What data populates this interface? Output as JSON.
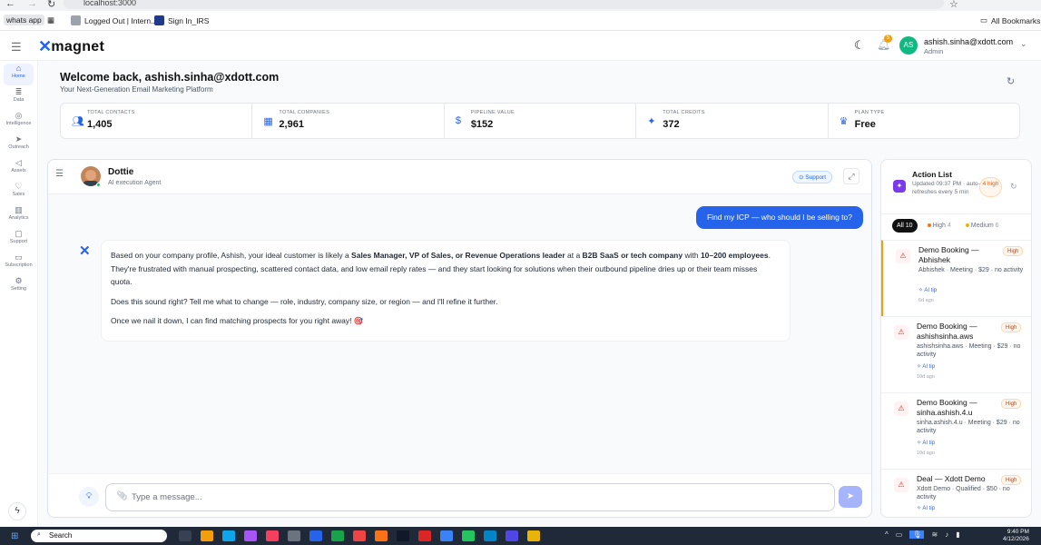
{
  "browser": {
    "url": "localhost:3000",
    "bookmarks": [
      "whats app",
      "Logged Out | Intern...",
      "Sign In_IRS"
    ],
    "all_bookmarks": "All Bookmarks"
  },
  "header": {
    "brand": "magnet",
    "user_email": "ashish.sinha@xdott.com",
    "user_role": "Admin",
    "avatar_initials": "AS",
    "notification_count": "5"
  },
  "sidebar": {
    "items": [
      {
        "label": "Home",
        "icon": "home-icon"
      },
      {
        "label": "Data",
        "icon": "database-icon"
      },
      {
        "label": "Intelligence",
        "icon": "brain-icon"
      },
      {
        "label": "Outreach",
        "icon": "send-icon"
      },
      {
        "label": "Assets",
        "icon": "megaphone-icon"
      },
      {
        "label": "Sales",
        "icon": "handshake-icon"
      },
      {
        "label": "Analytics",
        "icon": "bar-chart-icon"
      },
      {
        "label": "Support",
        "icon": "chat-icon"
      },
      {
        "label": "Subscription",
        "icon": "card-icon"
      },
      {
        "label": "Setting",
        "icon": "gear-icon"
      }
    ]
  },
  "welcome": {
    "title": "Welcome back, ashish.sinha@xdott.com",
    "subtitle": "Your Next-Generation Email Marketing Platform"
  },
  "stats": [
    {
      "label": "TOTAL CONTACTS",
      "value": "1,405",
      "icon": "users-icon"
    },
    {
      "label": "TOTAL COMPANIES",
      "value": "2,961",
      "icon": "building-icon"
    },
    {
      "label": "PIPELINE VALUE",
      "value": "$152",
      "icon": "dollar-icon"
    },
    {
      "label": "TOTAL CREDITS",
      "value": "372",
      "icon": "sparkle-icon"
    },
    {
      "label": "PLAN TYPE",
      "value": "Free",
      "icon": "crown-icon"
    }
  ],
  "chat": {
    "agent_name": "Dottie",
    "agent_role": "AI execution Agent",
    "support_label": "Support",
    "user_message": "Find my ICP — who should I be selling to?",
    "bot_p1_a": "Based on your company profile, Ashish, your ideal customer is likely a ",
    "bot_p1_b": "Sales Manager, VP of Sales, or Revenue Operations leader",
    "bot_p1_c": " at a ",
    "bot_p1_d": "B2B SaaS or tech company",
    "bot_p1_e": " with ",
    "bot_p1_f": "10–200 employees",
    "bot_p1_g": ". They're frustrated with manual prospecting, scattered contact data, and low email reply rates — and they start looking for solutions when their outbound pipeline dries up or their team misses quota.",
    "bot_p2": "Does this sound right? Tell me what to change — role, industry, company size, or region — and I'll refine it further.",
    "bot_p3": "Once we nail it down, I can find matching prospects for you right away! 🎯",
    "input_placeholder": "Type a message..."
  },
  "action_list": {
    "title": "Action List",
    "updated": "Updated 09:37 PM · auto-refreshes every 5 min",
    "high_badge": "4 high",
    "tabs": [
      {
        "label": "All 10"
      },
      {
        "label": "High",
        "count": "4",
        "color": "#f97316"
      },
      {
        "label": "Medium",
        "count": "6",
        "color": "#eab308"
      }
    ],
    "items": [
      {
        "title": "Demo Booking — Abhishek",
        "priority": "High",
        "meta": "Abhishek · Meeting · $29 · no activity",
        "tip": "AI tip",
        "ago": "6d ago"
      },
      {
        "title": "Demo Booking — ashishsinha.aws",
        "priority": "High",
        "meta": "ashishsinha.aws · Meeting · $29 · no activity",
        "tip": "AI tip",
        "ago": "10d ago"
      },
      {
        "title": "Demo Booking — sinha.ashish.4.u",
        "priority": "High",
        "meta": "sinha.ashish.4.u · Meeting · $29 · no activity",
        "tip": "AI tip",
        "ago": "10d ago"
      },
      {
        "title": "Deal — Xdott Demo",
        "priority": "High",
        "meta": "Xdott Demo · Qualified · $50 · no activity",
        "tip": "AI tip",
        "ago": ""
      }
    ]
  },
  "taskbar": {
    "search_placeholder": "Search",
    "time": "9:40 PM",
    "date": "4/12/2026"
  }
}
